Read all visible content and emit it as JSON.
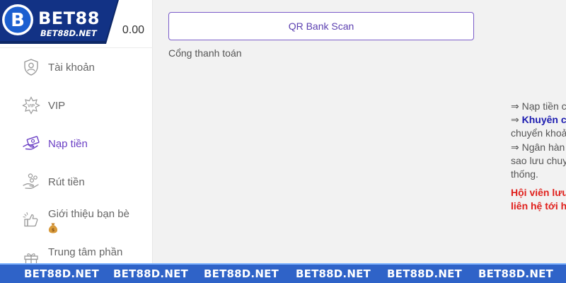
{
  "brand": {
    "logo_text": "BET88",
    "logo_subtext": "BET88D.NET"
  },
  "balance": "0.00",
  "menu": [
    {
      "label": "Tài khoản",
      "icon": "shield-user-icon",
      "active": false
    },
    {
      "label": "VIP",
      "icon": "vip-badge-icon",
      "active": false
    },
    {
      "label": "Nạp tiền",
      "icon": "deposit-hand-icon",
      "active": true
    },
    {
      "label": "Rút tiền",
      "icon": "withdraw-coins-icon",
      "active": false
    },
    {
      "label": "Giới thiệu bạn bè",
      "icon": "thumbs-up-icon",
      "active": false
    },
    {
      "label": "Trung tâm phần",
      "icon": "gift-icon",
      "active": false
    }
  ],
  "main": {
    "qr_button": "QR Bank Scan",
    "gateway_label": "Cổng thanh toán",
    "notes": {
      "line1": "⇒ Nạp tiền c",
      "line2_prefix": "⇒ ",
      "line2_highlight": "Khuyên c",
      "line3": "chuyển khoả",
      "line4": "⇒ Ngân hàn",
      "line5": "sao lưu chuy",
      "line6": "thống.",
      "warn1": "Hội viên lưu",
      "warn2": "liên hệ tới h"
    }
  },
  "footer": {
    "watermark": "BET88D.NET",
    "count": 6
  },
  "colors": {
    "accent": "#6a3fc4",
    "footer_band": "#2f63c8",
    "warning": "#e0201c",
    "highlight": "#1b1bb0"
  }
}
